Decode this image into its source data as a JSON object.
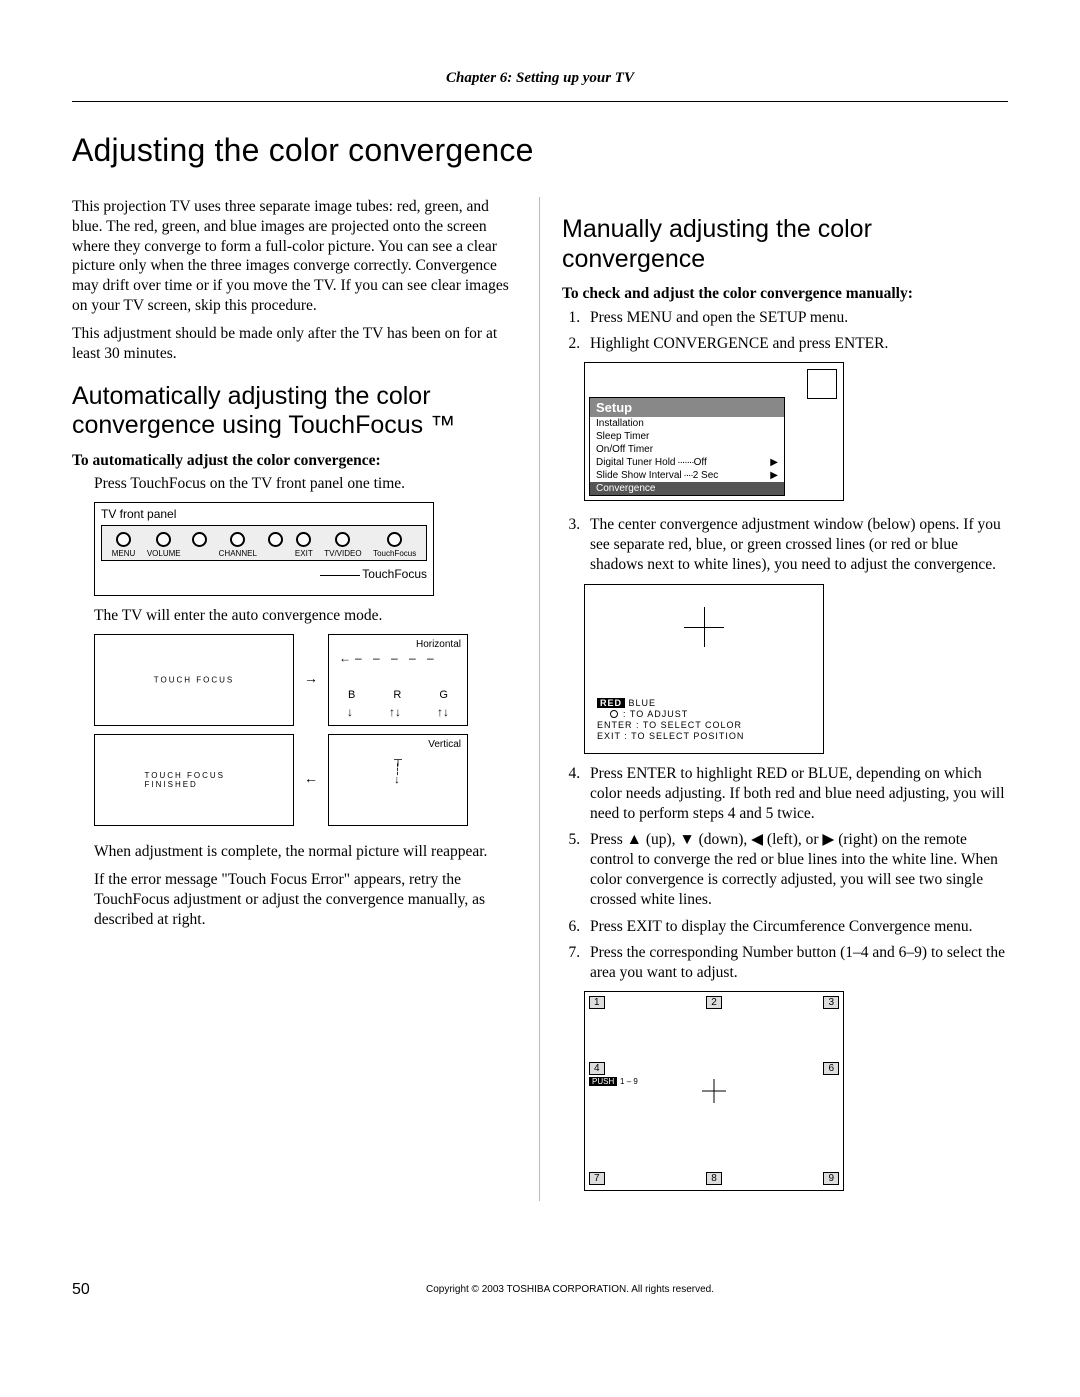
{
  "header": {
    "chapter": "Chapter 6: Setting up your TV"
  },
  "title": "Adjusting the color convergence",
  "left": {
    "intro1": "This projection TV uses three separate image tubes: red, green, and blue. The red, green, and blue images are projected onto the screen where they converge to form a full-color picture. You can see a clear picture only when the three images converge correctly. Convergence may drift over time or if you move the TV. If you can see clear images on your TV screen, skip this procedure.",
    "intro2": "This adjustment should be made only after the TV has been on for at least 30 minutes.",
    "auto_title": "Automatically adjusting the color convergence using TouchFocus ™",
    "auto_instr_head": "To automatically adjust the color convergence:",
    "auto_instr_body": "Press TouchFocus on the TV front panel one time.",
    "tv_panel": {
      "label": "TV front panel",
      "buttons": [
        "MENU",
        "VOLUME",
        "",
        "CHANNEL",
        "",
        "EXIT",
        "TV/VIDEO",
        "TouchFocus"
      ],
      "callout": "TouchFocus"
    },
    "auto_mode_text": "The TV will enter the auto convergence mode.",
    "diag": {
      "touch_focus": "TOUCH  FOCUS",
      "touch_focus_finished": "TOUCH  FOCUS  FINISHED",
      "horizontal": "Horizontal",
      "vertical": "Vertical",
      "b": "B",
      "r": "R",
      "g": "G"
    },
    "complete_text": "When adjustment is complete, the normal picture will reappear.",
    "error_text": "If the error message \"Touch Focus Error\" appears, retry the TouchFocus adjustment or adjust the convergence manually, as described at right."
  },
  "right": {
    "manual_title": "Manually adjusting the color convergence",
    "manual_instr_head": "To check and adjust the color convergence manually:",
    "steps": [
      "Press MENU and open the SETUP menu.",
      "Highlight CONVERGENCE and press ENTER.",
      "The center convergence adjustment window (below) opens. If you see separate red, blue, or green crossed lines (or red or blue shadows next to white lines), you need to adjust the convergence.",
      "Press ENTER to highlight RED or BLUE, depending on which color needs adjusting. If both red and blue need adjusting, you will need to perform steps 4 and 5 twice.",
      "Press ▲ (up), ▼ (down), ◀ (left), or ▶ (right) on the remote control to converge the red or blue lines into the white line. When color convergence is correctly adjusted, you will see two single crossed white lines.",
      "Press EXIT to display the Circumference Convergence menu.",
      "Press the corresponding Number button (1–4 and 6–9) to select the area you want to adjust."
    ],
    "setup_menu": {
      "title": "Setup",
      "items": [
        {
          "label": "Installation"
        },
        {
          "label": "Sleep Timer"
        },
        {
          "label": "On/Off Timer"
        },
        {
          "label": "Digital Tuner Hold",
          "value": "Off",
          "dots": true,
          "arrow": true
        },
        {
          "label": "Slide Show Interval",
          "value": "2 Sec",
          "dots": true,
          "arrow": true
        },
        {
          "label": "Convergence",
          "hl": true
        }
      ]
    },
    "conv_window": {
      "red": "RED",
      "blue": "BLUE",
      "line1": ": TO  ADJUST",
      "line2": "ENTER  : TO  SELECT  COLOR",
      "line3": "EXIT    : TO  SELECT  POSITION"
    },
    "num_grid": {
      "cells": [
        "1",
        "2",
        "3",
        "4",
        "",
        "6",
        "7",
        "8",
        "9"
      ],
      "push": "PUSH",
      "range": "1 – 9"
    }
  },
  "footer": {
    "page": "50",
    "copyright": "Copyright © 2003 TOSHIBA CORPORATION. All rights reserved."
  }
}
